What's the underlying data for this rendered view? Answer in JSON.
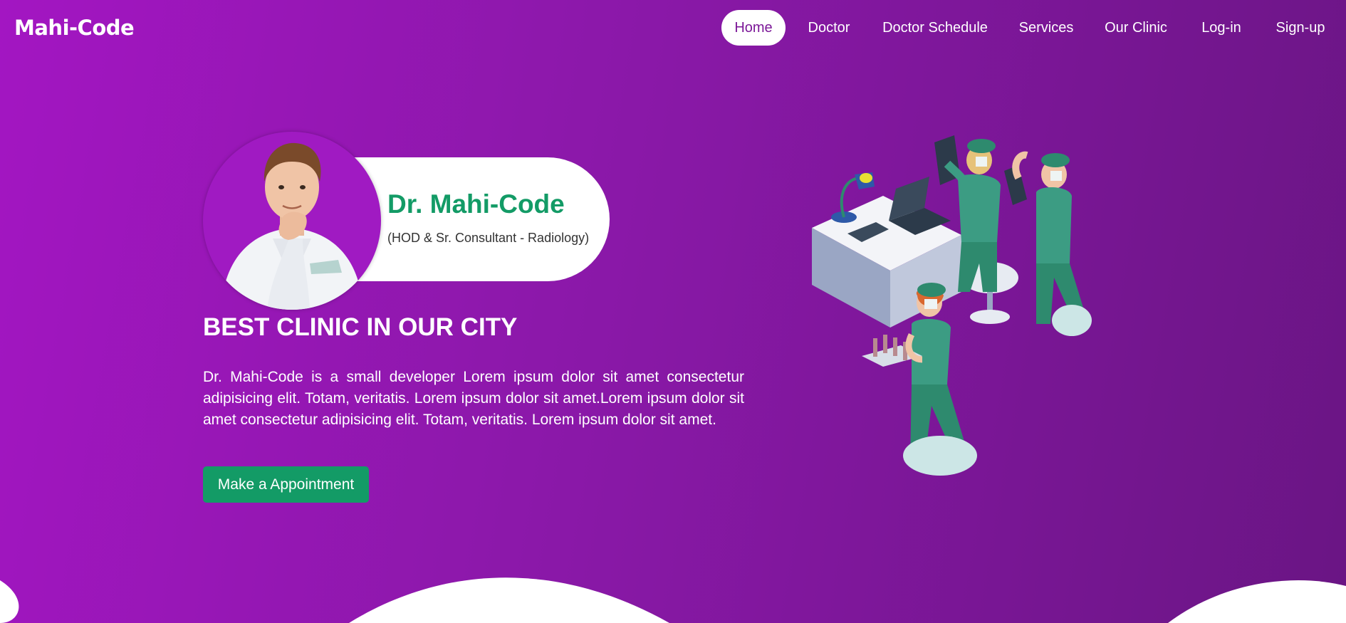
{
  "navbar": {
    "brand": "Mahi-Code",
    "items": [
      {
        "label": "Home",
        "active": true
      },
      {
        "label": "Doctor",
        "active": false
      },
      {
        "label": "Doctor Schedule",
        "active": false
      },
      {
        "label": "Services",
        "active": false
      },
      {
        "label": "Our Clinic",
        "active": false
      },
      {
        "label": "Log-in",
        "active": false
      },
      {
        "label": "Sign-up",
        "active": false
      }
    ]
  },
  "hero": {
    "doctor_name": "Dr. Mahi-Code",
    "doctor_title": "(HOD & Sr. Consultant - Radiology)",
    "heading": "BEST CLINIC IN OUR CITY",
    "description": "Dr. Mahi-Code is a small developer Lorem ipsum dolor sit amet consectetur adipisicing elit. Totam, veritatis. Lorem ipsum dolor sit amet.Lorem ipsum dolor sit amet consectetur adipisicing elit. Totam, veritatis. Lorem ipsum dolor sit amet.",
    "cta_label": "Make a Appointment"
  },
  "colors": {
    "gradient_start": "#a316c2",
    "gradient_end": "#6a1584",
    "accent_green": "#139b66",
    "active_nav_text": "#7c1898"
  }
}
